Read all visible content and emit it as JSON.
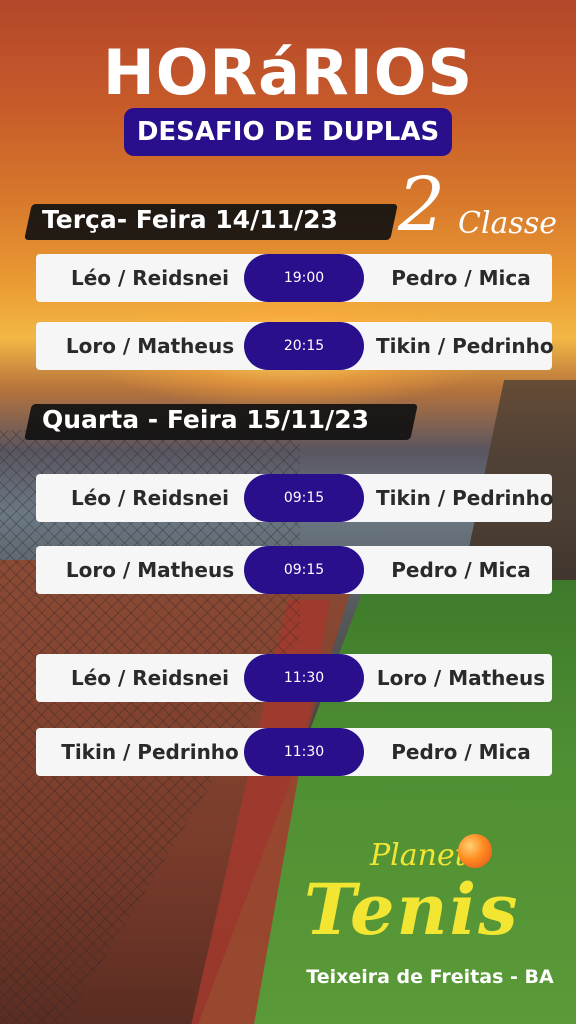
{
  "header": {
    "title": "HORáRIOS",
    "subtitle": "DESAFIO DE DUPLAS"
  },
  "classe": {
    "number": "2",
    "word": "Classe"
  },
  "days": [
    {
      "label": "Terça- Feira 14/11/23",
      "matches": [
        {
          "team_left": "Léo / Reidsnei",
          "time": "19:00",
          "team_right": "Pedro / Mica"
        },
        {
          "team_left": "Loro / Matheus",
          "time": "20:15",
          "team_right": "Tikin / Pedrinho"
        }
      ]
    },
    {
      "label": "Quarta - Feira 15/11/23",
      "matches": [
        {
          "team_left": "Léo / Reidsnei",
          "time": "09:15",
          "team_right": "Tikin / Pedrinho"
        },
        {
          "team_left": "Loro / Matheus",
          "time": "09:15",
          "team_right": "Pedro / Mica"
        },
        {
          "team_left": "Léo / Reidsnei",
          "time": "11:30",
          "team_right": "Loro / Matheus"
        },
        {
          "team_left": "Tikin / Pedrinho",
          "time": "11:30",
          "team_right": "Pedro / Mica"
        }
      ]
    }
  ],
  "logo": {
    "line1": "Planeta",
    "line2": "Tenis"
  },
  "location": "Teixeira de Freitas - BA",
  "colors": {
    "accent": "#2a0f8c",
    "logo_yellow": "#f2e633",
    "card_bg": "#f6f6f6"
  }
}
